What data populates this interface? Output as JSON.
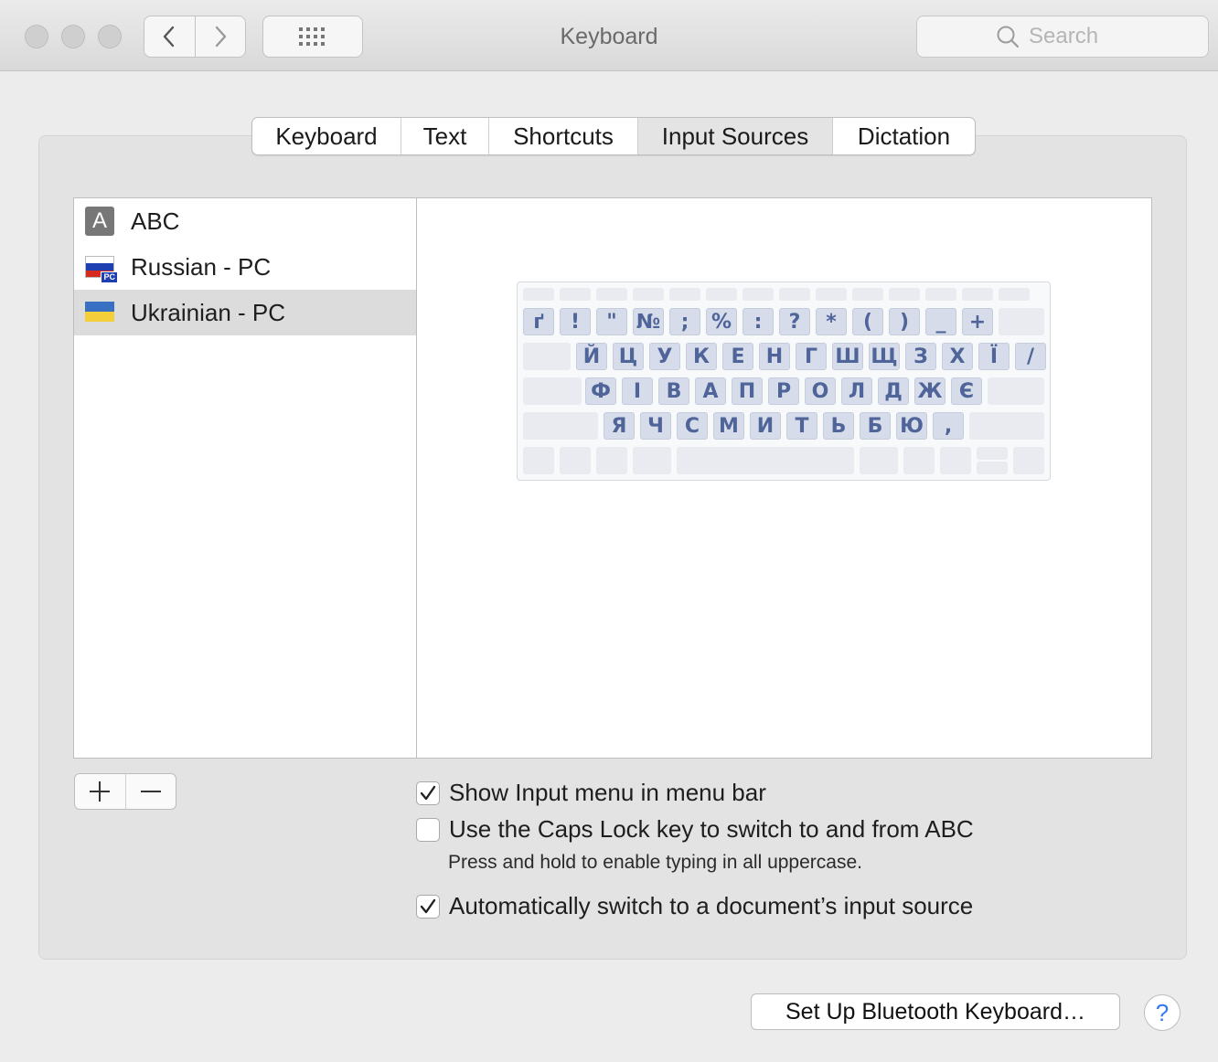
{
  "window": {
    "title": "Keyboard"
  },
  "toolbar": {
    "search_placeholder": "Search",
    "back_icon": "chevron-left-icon",
    "forward_icon": "chevron-right-icon",
    "grid_icon": "grid-icon"
  },
  "tabs": [
    {
      "label": "Keyboard",
      "active": false
    },
    {
      "label": "Text",
      "active": false
    },
    {
      "label": "Shortcuts",
      "active": false
    },
    {
      "label": "Input Sources",
      "active": true
    },
    {
      "label": "Dictation",
      "active": false
    }
  ],
  "input_sources": [
    {
      "label": "ABC",
      "icon": "abc-icon",
      "icon_text": "A",
      "selected": false
    },
    {
      "label": "Russian - PC",
      "icon": "russia-flag-icon",
      "icon_badge": "PC",
      "selected": false
    },
    {
      "label": "Ukrainian - PC",
      "icon": "ukraine-flag-icon",
      "selected": true
    }
  ],
  "keyboard_layout": {
    "row1": [
      "ґ",
      "!",
      "\"",
      "№",
      ";",
      "%",
      ":",
      "?",
      "*",
      "(",
      ")",
      "_",
      "+"
    ],
    "row2": [
      "Й",
      "Ц",
      "У",
      "К",
      "Е",
      "Н",
      "Г",
      "Ш",
      "Щ",
      "З",
      "Х",
      "Ї",
      "/"
    ],
    "row3": [
      "Ф",
      "І",
      "В",
      "А",
      "П",
      "Р",
      "О",
      "Л",
      "Д",
      "Ж",
      "Є"
    ],
    "row4": [
      "Я",
      "Ч",
      "С",
      "М",
      "И",
      "Т",
      "Ь",
      "Б",
      "Ю",
      ","
    ]
  },
  "list_controls": {
    "add_label": "+",
    "remove_label": "—"
  },
  "options": {
    "show_input_menu": {
      "label": "Show Input menu in menu bar",
      "checked": true
    },
    "caps_lock_switch": {
      "label": "Use the Caps Lock key to switch to and from ABC",
      "checked": false
    },
    "caps_lock_hint": "Press and hold to enable typing in all uppercase.",
    "auto_switch": {
      "label": "Automatically switch to a document’s input source",
      "checked": true
    }
  },
  "footer": {
    "bluetooth_button": "Set Up Bluetooth Keyboard…",
    "help_label": "?"
  },
  "colors": {
    "key_label": "#4f6499",
    "ru_flag": [
      "#ffffff",
      "#1d3fb1",
      "#d52b1e"
    ],
    "ua_flag": [
      "#3a70c4",
      "#f4cf3b"
    ]
  }
}
